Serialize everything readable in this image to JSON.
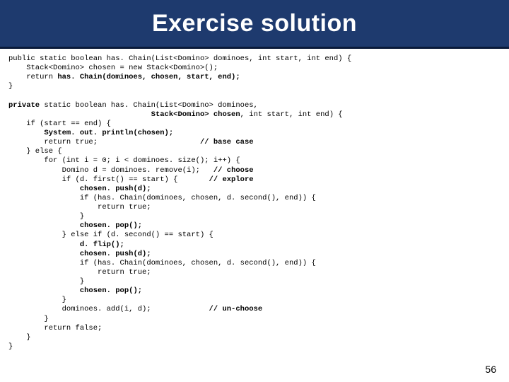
{
  "title": "Exercise solution",
  "page_number": "56",
  "code": {
    "l01a": "public static boolean has. Chain(List<Domino> dominoes, int start, int end) {",
    "l02": "    Stack<Domino> chosen = new Stack<Domino>();",
    "l03a": "    return ",
    "l03b": "has. Chain(dominoes, chosen, start, end);",
    "l04": "}",
    "l05": "",
    "l06a": "private",
    "l06b": " static boolean has. Chain(List<Domino> dominoes,",
    "l07a": "                                ",
    "l07b": "Stack<Domino> chosen",
    "l07c": ", int start, int end) {",
    "l08": "    if (start == end) {",
    "l09a": "        ",
    "l09b": "System. out. println(chosen);",
    "l10a": "        return true;                       ",
    "l10b": "// base case",
    "l11": "    } else {",
    "l12": "        for (int i = 0; i < dominoes. size(); i++) {",
    "l13a": "            Domino d = dominoes. remove(i);   ",
    "l13b": "// choose",
    "l14a": "            if (d. first() == start) {       ",
    "l14b": "// explore",
    "l15a": "                ",
    "l15b": "chosen. push(d);",
    "l16": "                if (has. Chain(dominoes, chosen, d. second(), end)) {",
    "l17": "                    return true;",
    "l18": "                }",
    "l19a": "                ",
    "l19b": "chosen. pop();",
    "l20": "            } else if (d. second() == start) {",
    "l21a": "                ",
    "l21b": "d. flip();",
    "l22a": "                ",
    "l22b": "chosen. push(d);",
    "l23": "                if (has. Chain(dominoes, chosen, d. second(), end)) {",
    "l24": "                    return true;",
    "l25": "                }",
    "l26a": "                ",
    "l26b": "chosen. pop();",
    "l27": "            }",
    "l28a": "            dominoes. add(i, d);             ",
    "l28b": "// un-choose",
    "l29": "        }",
    "l30": "        return false;",
    "l31": "    }",
    "l32": "}"
  }
}
